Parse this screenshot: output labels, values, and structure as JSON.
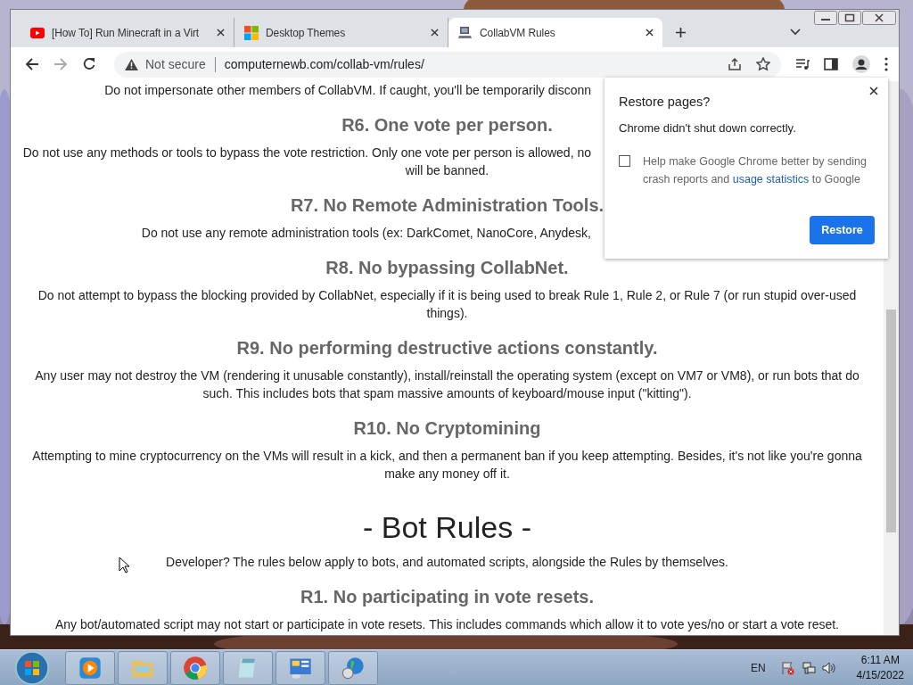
{
  "tabs": [
    {
      "title": "[How To] Run Minecraft in a Virt",
      "selected": false
    },
    {
      "title": "Desktop Themes",
      "selected": false
    },
    {
      "title": "CollabVM Rules",
      "selected": true
    }
  ],
  "toolbar": {
    "security": "Not secure",
    "url": "computernewb.com/collab-vm/rules/"
  },
  "content": [
    {
      "kind": "paragraph",
      "lines": [
        {
          "kind": "cut",
          "text": "Do not impersonate other members of CollabVM. If caught, you'll be temporarily disconn"
        }
      ]
    },
    {
      "kind": "heading",
      "text": "R6. One vote per person."
    },
    {
      "kind": "paragraph",
      "lines": [
        {
          "kind": "cut",
          "text": "Do not use any methods or tools to bypass the vote restriction. Only one vote per person is allowed, no"
        },
        {
          "kind": "line",
          "text": "will be banned."
        }
      ]
    },
    {
      "kind": "heading",
      "text": "R7. No Remote Administration Tools."
    },
    {
      "kind": "paragraph",
      "lines": [
        {
          "kind": "cut",
          "text": "Do not use any remote administration tools (ex: DarkComet, NanoCore, Anydesk,"
        }
      ]
    },
    {
      "kind": "heading",
      "text": "R8. No bypassing CollabNet."
    },
    {
      "kind": "paragraph",
      "lines": [
        {
          "kind": "line",
          "text": "Do not attempt to bypass the blocking provided by CollabNet, especially if it is being used to break Rule 1, Rule 2, or Rule 7 (or run stupid over-used"
        },
        {
          "kind": "line",
          "text": "things)."
        }
      ]
    },
    {
      "kind": "heading",
      "text": "R9. No performing destructive actions constantly."
    },
    {
      "kind": "paragraph",
      "lines": [
        {
          "kind": "line",
          "text": "Any user may not destroy the VM (rendering it unusable constantly), install/reinstall the operating system (except on VM7 or VM8), or run bots that do"
        },
        {
          "kind": "line",
          "text": "such. This includes bots that spam massive amounts of keyboard/mouse input (\"kitting\")."
        }
      ]
    },
    {
      "kind": "heading",
      "text": "R10. No Cryptomining"
    },
    {
      "kind": "paragraph",
      "lines": [
        {
          "kind": "line",
          "text": "Attempting to mine cryptocurrency on the VMs will result in a kick, and then a permanent ban if you keep attempting. Besides, it's not like you're gonna"
        },
        {
          "kind": "line",
          "text": "make any money off it."
        }
      ]
    },
    {
      "kind": "title",
      "text": "- Bot Rules -"
    },
    {
      "kind": "paragraph",
      "lines": [
        {
          "kind": "line",
          "text": "Developer? The rules below apply to bots, and automated scripts, alongside the Rules by themselves."
        }
      ]
    },
    {
      "kind": "heading",
      "text": "R1. No participating in vote resets."
    },
    {
      "kind": "paragraph",
      "lines": [
        {
          "kind": "line",
          "text": "Any bot/automated script may not start or participate in vote resets. This includes commands which allow it to vote yes/no or start a vote reset."
        }
      ]
    }
  ],
  "popup": {
    "title": "Restore pages?",
    "message": "Chrome didn't shut down correctly.",
    "checkbox": {
      "checked": false,
      "label": "Help make Google Chrome better by sending crash reports and",
      "link": "usage statistics",
      "label_end": "to Google"
    },
    "button": "Restore"
  },
  "taskbar": {
    "language": "EN",
    "time": "6:11 AM",
    "date": "4/15/2022"
  }
}
